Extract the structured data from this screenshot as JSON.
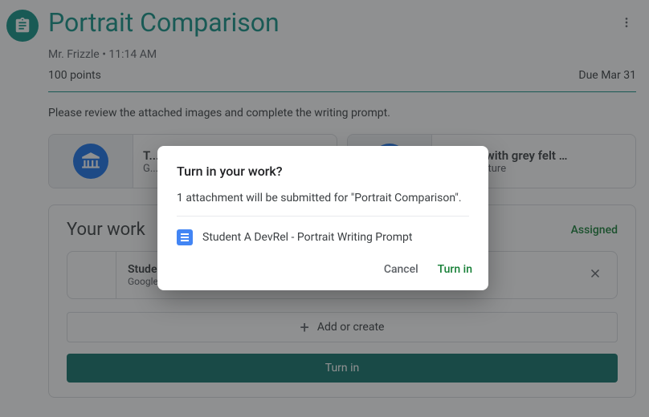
{
  "header": {
    "title": "Portrait Comparison",
    "meta": "Mr. Frizzle • 11:14 AM"
  },
  "assignment": {
    "points": "100 points",
    "due": "Due Mar 31",
    "description": "Please review the attached images and complete the writing prompt."
  },
  "attachments": [
    {
      "title": "T...",
      "subtitle": "G...",
      "icon": "museum-icon"
    },
    {
      "title": "Portrait with grey felt …",
      "subtitle": "Arts & Culture",
      "icon": "museum-icon"
    }
  ],
  "work": {
    "section_title": "Your work",
    "status": "Assigned",
    "item": {
      "title": "Student A DevRel - Portrait Writing Prompt",
      "subtitle": "Google Docs"
    },
    "add_label": "Add or create",
    "turn_in_label": "Turn in"
  },
  "dialog": {
    "title": "Turn in your work?",
    "body": "1 attachment will be submitted for \"Portrait Comparison\".",
    "attachment": "Student A DevRel - Portrait Writing Prompt",
    "cancel": "Cancel",
    "confirm": "Turn in"
  },
  "colors": {
    "primary": "#129387"
  }
}
